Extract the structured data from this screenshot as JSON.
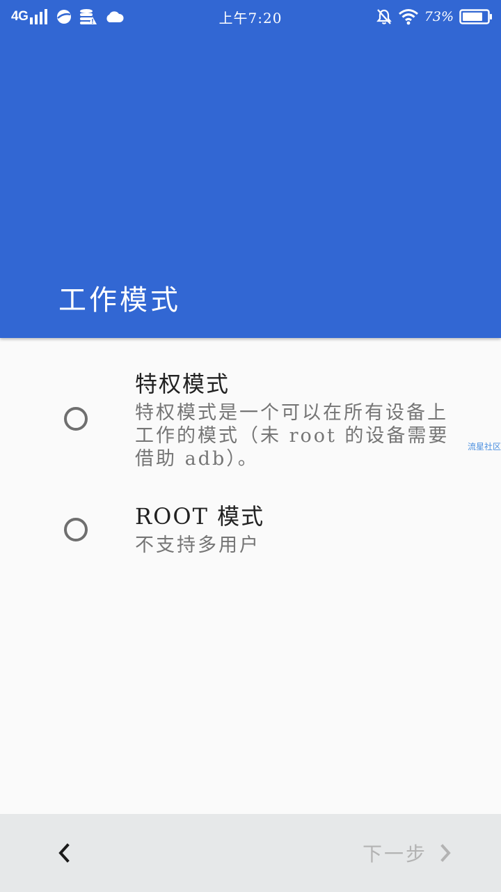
{
  "status_bar": {
    "network": "4G",
    "time": "上午7:20",
    "battery_percent": "73%",
    "icons_left": [
      "signal-icon",
      "browser-icon",
      "storage-warning-icon",
      "cloud-icon"
    ],
    "icons_right": [
      "alarm-off-icon",
      "wifi-icon",
      "battery-icon"
    ]
  },
  "header": {
    "title": "工作模式",
    "color": "#3267d3"
  },
  "options": [
    {
      "title": "特权模式",
      "description": "特权模式是一个可以在所有设备上工作的模式（未 root 的设备需要借助 adb）。"
    },
    {
      "title": "ROOT 模式",
      "description": "不支持多用户"
    }
  ],
  "watermark": "流星社区",
  "footer": {
    "next_label": "下一步"
  }
}
